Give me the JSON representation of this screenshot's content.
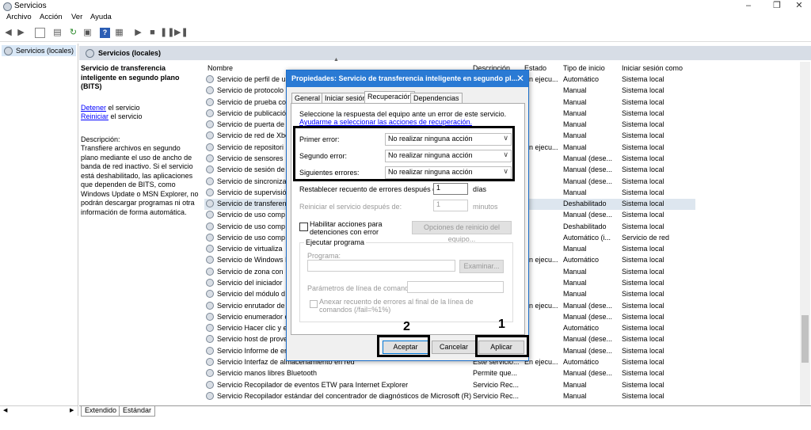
{
  "window": {
    "title": "Servicios",
    "icons": [
      "gear-icon",
      "minimize-icon",
      "maximize-icon",
      "close-icon"
    ]
  },
  "menu": [
    "Archivo",
    "Acción",
    "Ver",
    "Ayuda"
  ],
  "tree": {
    "root": "Servicios (locales)"
  },
  "header": {
    "title": "Servicios (locales)"
  },
  "description": {
    "title": "Servicio de transferencia inteligente en segundo plano (BITS)",
    "stop_link": "Detener",
    "stop_rest": " el servicio",
    "restart_link": "Reiniciar",
    "restart_rest": " el servicio",
    "desc_label": "Descripción:",
    "desc_text": "Transfiere archivos en segundo plano mediante el uso de ancho de banda de red inactivo. Si el servicio está deshabilitado, las aplicaciones que dependen de BITS, como Windows Update o MSN Explorer, no podrán descargar programas ni otra información de forma automática."
  },
  "columns": {
    "name": "Nombre",
    "description": "Descripción",
    "status": "Estado",
    "startup": "Tipo de inicio",
    "logon": "Iniciar sesión como"
  },
  "rows": [
    {
      "name": "Servicio de perfil de us",
      "desc": "",
      "status": "En ejecu...",
      "startup": "Automático",
      "logon": "Sistema local"
    },
    {
      "name": "Servicio de protocolo",
      "desc": "",
      "status": "",
      "startup": "Manual",
      "logon": "Sistema local"
    },
    {
      "name": "Servicio de prueba co",
      "desc": "",
      "status": "",
      "startup": "Manual",
      "logon": "Sistema local"
    },
    {
      "name": "Servicio de publicació",
      "desc": "",
      "status": "",
      "startup": "Manual",
      "logon": "Sistema local"
    },
    {
      "name": "Servicio de puerta de",
      "desc": "",
      "status": "",
      "startup": "Manual",
      "logon": "Sistema local"
    },
    {
      "name": "Servicio de red de Xbo",
      "desc": "",
      "status": "",
      "startup": "Manual",
      "logon": "Sistema local"
    },
    {
      "name": "Servicio de repositori",
      "desc": "",
      "status": "En ejecu...",
      "startup": "Manual",
      "logon": "Sistema local"
    },
    {
      "name": "Servicio de sensores",
      "desc": "",
      "status": "",
      "startup": "Manual (dese...",
      "logon": "Sistema local"
    },
    {
      "name": "Servicio de sesión de",
      "desc": "",
      "status": "",
      "startup": "Manual (dese...",
      "logon": "Sistema local"
    },
    {
      "name": "Servicio de sincroniza",
      "desc": "",
      "status": "",
      "startup": "Manual (dese...",
      "logon": "Sistema local"
    },
    {
      "name": "Servicio de supervisió",
      "desc": "",
      "status": "",
      "startup": "Manual",
      "logon": "Sistema local"
    },
    {
      "name": "Servicio de transferen",
      "desc": "",
      "status": "",
      "startup": "Deshabilitado",
      "logon": "Sistema local",
      "selected": true
    },
    {
      "name": "Servicio de uso comp",
      "desc": "",
      "status": "",
      "startup": "Manual (dese...",
      "logon": "Sistema local"
    },
    {
      "name": "Servicio de uso comp",
      "desc": "",
      "status": "",
      "startup": "Deshabilitado",
      "logon": "Sistema local"
    },
    {
      "name": "Servicio de uso comp",
      "desc": "",
      "status": "",
      "startup": "Automático (i...",
      "logon": "Servicio de red"
    },
    {
      "name": "Servicio de virtualiza",
      "desc": "",
      "status": "",
      "startup": "Manual",
      "logon": "Sistema local"
    },
    {
      "name": "Servicio de Windows I",
      "desc": "",
      "status": "En ejecu...",
      "startup": "Automático",
      "logon": "Sistema local"
    },
    {
      "name": "Servicio de zona con",
      "desc": "",
      "status": "",
      "startup": "Manual",
      "logon": "Sistema local"
    },
    {
      "name": "Servicio del iniciador",
      "desc": "",
      "status": "",
      "startup": "Manual",
      "logon": "Sistema local"
    },
    {
      "name": "Servicio del módulo d",
      "desc": "",
      "status": "",
      "startup": "Manual",
      "logon": "Sistema local"
    },
    {
      "name": "Servicio enrutador de",
      "desc": "",
      "status": "En ejecu...",
      "startup": "Manual (dese...",
      "logon": "Sistema local"
    },
    {
      "name": "Servicio enumerador c",
      "desc": "",
      "status": "",
      "startup": "Manual (dese...",
      "logon": "Sistema local"
    },
    {
      "name": "Servicio Hacer clic y e",
      "desc": "",
      "status": "",
      "startup": "Automático",
      "logon": "Sistema local"
    },
    {
      "name": "Servicio host de prove",
      "desc": "",
      "status": "",
      "startup": "Manual (dese...",
      "logon": "Sistema local"
    },
    {
      "name": "Servicio Informe de er",
      "desc": "",
      "status": "",
      "startup": "Manual (dese...",
      "logon": "Sistema local"
    },
    {
      "name": "Servicio Interfaz de almacenamiento en red",
      "desc": "Este servicio...",
      "status": "En ejecu...",
      "startup": "Automático",
      "logon": "Sistema local"
    },
    {
      "name": "Servicio manos libres Bluetooth",
      "desc": "Permite que...",
      "status": "",
      "startup": "Manual (dese...",
      "logon": "Sistema local"
    },
    {
      "name": "Servicio Recopilador de eventos ETW para Internet Explorer",
      "desc": "Servicio Rec...",
      "status": "",
      "startup": "Manual",
      "logon": "Sistema local"
    },
    {
      "name": "Servicio Recopilador estándar del concentrador de diagnósticos de Microsoft (R)",
      "desc": "Servicio Rec...",
      "status": "",
      "startup": "Manual",
      "logon": "Sistema local"
    }
  ],
  "bottom_tabs": [
    "Extendido",
    "Estándar"
  ],
  "dialog": {
    "title": "Propiedades: Servicio de transferencia inteligente en segundo pl...",
    "tabs": [
      "General",
      "Iniciar sesión",
      "Recuperación",
      "Dependencias"
    ],
    "intro": "Seleccione la respuesta del equipo ante un error de este servicio.",
    "help_link": "Ayudarme a seleccionar las acciones de recuperación.",
    "first_label": "Primer error:",
    "first_value": "No realizar ninguna acción",
    "second_label": "Segundo error:",
    "second_value": "No realizar ninguna acción",
    "subsequent_label": "Siguientes errores:",
    "subsequent_value": "No realizar ninguna acción",
    "reset_label": "Restablecer recuento de errores después de:",
    "reset_value": "1",
    "reset_unit": "días",
    "restart_label": "Reiniciar el servicio después de:",
    "restart_value": "1",
    "restart_unit": "minutos",
    "enable_actions_label": "Habilitar acciones para detenciones con error",
    "restart_options_button": "Opciones de reinicio del equipo...",
    "run_program_legend": "Ejecutar programa",
    "program_label": "Programa:",
    "browse_button": "Examinar...",
    "params_label": "Parámetros de línea de comandos:",
    "append_label": "Anexar recuento de errores al final de la línea de comandos (/fail=%1%)",
    "ok_button": "Aceptar",
    "cancel_button": "Cancelar",
    "apply_button": "Aplicar"
  },
  "annotations": {
    "apply_number": "1",
    "ok_number": "2"
  }
}
